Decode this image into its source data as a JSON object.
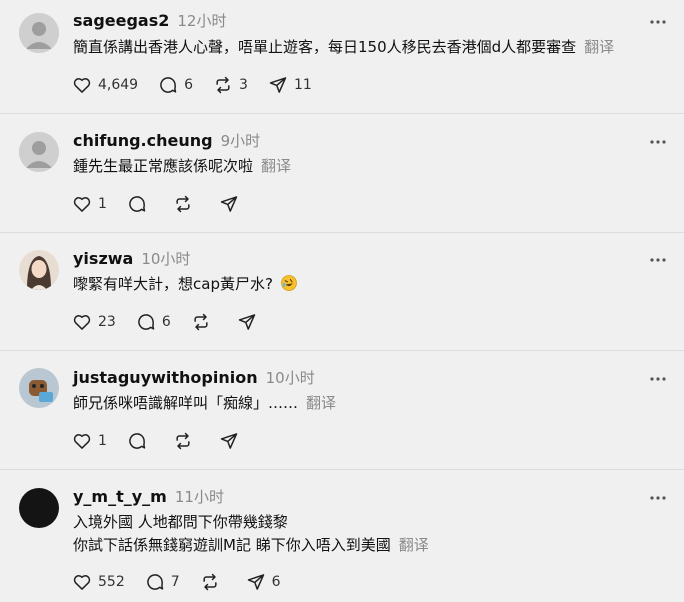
{
  "posts": [
    {
      "username": "sageegas2",
      "time": "12小时",
      "text_lines": [
        "簡直係講出香港人心聲，唔單止遊客，每日150人移民去香港個d人都要審查"
      ],
      "translate": "翻译",
      "likes": "4,649",
      "replies": "6",
      "reposts": "3",
      "shares": "11"
    },
    {
      "username": "chifung.cheung",
      "time": "9小时",
      "text_lines": [
        "鍾先生最正常應該係呢次啦"
      ],
      "translate": "翻译",
      "likes": "1",
      "replies": "",
      "reposts": "",
      "shares": ""
    },
    {
      "username": "yiszwa",
      "time": "10小时",
      "text_lines": [
        "嚟緊有咩大計，想cap黃尸水?"
      ],
      "emoji": "rolling-on-floor-laughing",
      "translate": "",
      "likes": "23",
      "replies": "6",
      "reposts": "",
      "shares": ""
    },
    {
      "username": "justaguywithopinion",
      "time": "10小时",
      "text_lines": [
        "師兄係咪唔識解咩叫「痴線」……"
      ],
      "translate": "翻译",
      "likes": "1",
      "replies": "",
      "reposts": "",
      "shares": ""
    },
    {
      "username": "y_m_t_y_m",
      "time": "11小时",
      "text_lines": [
        "入境外國 人地都問下你帶幾錢黎",
        "你試下話係無錢窮遊訓M記 睇下你入唔入到美國"
      ],
      "translate": "翻译",
      "likes": "552",
      "replies": "7",
      "reposts": "",
      "shares": "6"
    }
  ],
  "icons": {
    "more": "more-horizontal-icon",
    "like": "heart-icon",
    "reply": "comment-icon",
    "repost": "repost-icon",
    "share": "send-icon"
  },
  "colors": {
    "background": "#f0f0f0",
    "secondary_text": "#8a8a8a",
    "divider": "#dcdcdc"
  }
}
